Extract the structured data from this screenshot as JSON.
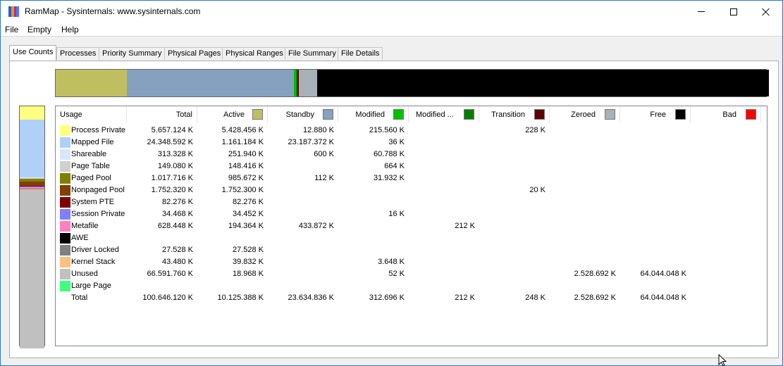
{
  "window": {
    "title": "RamMap - Sysinternals: www.sysinternals.com"
  },
  "menu": {
    "file": "File",
    "empty": "Empty",
    "help": "Help"
  },
  "tabs": [
    "Use Counts",
    "Processes",
    "Priority Summary",
    "Physical Pages",
    "Physical Ranges",
    "File Summary",
    "File Details"
  ],
  "active_tab": "Use Counts",
  "colors": {
    "active": "#bfbf60",
    "standby": "#86a0bf",
    "modified": "#00c000",
    "modified_no_write": "#008000",
    "transition": "#600000",
    "zeroed": "#a8b0b8",
    "free": "#000000",
    "bad": "#ff0000"
  },
  "columns": {
    "usage": "Usage",
    "total": "Total",
    "active": "Active",
    "standby": "Standby",
    "modified": "Modified",
    "modified_nw": "Modified ...",
    "transition": "Transition",
    "zeroed": "Zeroed",
    "free": "Free",
    "bad": "Bad"
  },
  "rows": [
    {
      "label": "Process Private",
      "color": "#ffff80",
      "total": "5.657.124 K",
      "active": "5.428.456 K",
      "standby": "12.880 K",
      "modified": "215.560 K",
      "modified_nw": "",
      "transition": "228 K",
      "zeroed": "",
      "free": ""
    },
    {
      "label": "Mapped File",
      "color": "#b0d0f8",
      "total": "24.348.592 K",
      "active": "1.161.184 K",
      "standby": "23.187.372 K",
      "modified": "36 K",
      "modified_nw": "",
      "transition": "",
      "zeroed": "",
      "free": ""
    },
    {
      "label": "Shareable",
      "color": "#d8e8f8",
      "total": "313.328 K",
      "active": "251.940 K",
      "standby": "600 K",
      "modified": "60.788 K",
      "modified_nw": "",
      "transition": "",
      "zeroed": "",
      "free": ""
    },
    {
      "label": "Page Table",
      "color": "#d0d0d0",
      "total": "149.080 K",
      "active": "148.416 K",
      "standby": "",
      "modified": "664 K",
      "modified_nw": "",
      "transition": "",
      "zeroed": "",
      "free": ""
    },
    {
      "label": "Paged Pool",
      "color": "#808000",
      "total": "1.017.716 K",
      "active": "985.672 K",
      "standby": "112 K",
      "modified": "31.932 K",
      "modified_nw": "",
      "transition": "",
      "zeroed": "",
      "free": ""
    },
    {
      "label": "Nonpaged Pool",
      "color": "#804000",
      "total": "1.752.320 K",
      "active": "1.752.300 K",
      "standby": "",
      "modified": "",
      "modified_nw": "",
      "transition": "20 K",
      "zeroed": "",
      "free": ""
    },
    {
      "label": "System PTE",
      "color": "#800000",
      "total": "82.276 K",
      "active": "82.276 K",
      "standby": "",
      "modified": "",
      "modified_nw": "",
      "transition": "",
      "zeroed": "",
      "free": ""
    },
    {
      "label": "Session Private",
      "color": "#8080ff",
      "total": "34.468 K",
      "active": "34.452 K",
      "standby": "",
      "modified": "16 K",
      "modified_nw": "",
      "transition": "",
      "zeroed": "",
      "free": ""
    },
    {
      "label": "Metafile",
      "color": "#ff80c0",
      "total": "628.448 K",
      "active": "194.364 K",
      "standby": "433.872 K",
      "modified": "",
      "modified_nw": "212 K",
      "transition": "",
      "zeroed": "",
      "free": ""
    },
    {
      "label": "AWE",
      "color": "#000000",
      "total": "",
      "active": "",
      "standby": "",
      "modified": "",
      "modified_nw": "",
      "transition": "",
      "zeroed": "",
      "free": ""
    },
    {
      "label": "Driver Locked",
      "color": "#808080",
      "total": "27.528 K",
      "active": "27.528 K",
      "standby": "",
      "modified": "",
      "modified_nw": "",
      "transition": "",
      "zeroed": "",
      "free": ""
    },
    {
      "label": "Kernel Stack",
      "color": "#ffc080",
      "total": "43.480 K",
      "active": "39.832 K",
      "standby": "",
      "modified": "3.648 K",
      "modified_nw": "",
      "transition": "",
      "zeroed": "",
      "free": ""
    },
    {
      "label": "Unused",
      "color": "#c0c0c0",
      "total": "66.591.760 K",
      "active": "18.968 K",
      "standby": "",
      "modified": "52 K",
      "modified_nw": "",
      "transition": "",
      "zeroed": "2.528.692 K",
      "free": "64.044.048 K"
    },
    {
      "label": "Large Page",
      "color": "#40ff80",
      "total": "",
      "active": "",
      "standby": "",
      "modified": "",
      "modified_nw": "",
      "transition": "",
      "zeroed": "",
      "free": ""
    },
    {
      "label": "Total",
      "color": "",
      "total": "100.646.120 K",
      "active": "10.125.388 K",
      "standby": "23.634.836 K",
      "modified": "312.696 K",
      "modified_nw": "212 K",
      "transition": "248 K",
      "zeroed": "2.528.692 K",
      "free": "64.044.048 K"
    }
  ],
  "memory_bar": [
    {
      "state": "active",
      "color": "#bfbf60",
      "kb": 10125388
    },
    {
      "state": "standby",
      "color": "#86a0bf",
      "kb": 23634836
    },
    {
      "state": "modified",
      "color": "#00c000",
      "kb": 312696
    },
    {
      "state": "modified_no_write",
      "color": "#008000",
      "kb": 212
    },
    {
      "state": "transition",
      "color": "#600000",
      "kb": 248
    },
    {
      "state": "zeroed",
      "color": "#a8b0b8",
      "kb": 2528692
    },
    {
      "state": "free",
      "color": "#000000",
      "kb": 64044048
    }
  ],
  "usage_bar": [
    {
      "usage": "process-private",
      "color": "#ffff80",
      "kb": 5657124
    },
    {
      "usage": "mapped-file",
      "color": "#b0d0f8",
      "kb": 24348592
    },
    {
      "usage": "shareable",
      "color": "#d8e8f8",
      "kb": 313328
    },
    {
      "usage": "page-table",
      "color": "#d0d0d0",
      "kb": 149080
    },
    {
      "usage": "paged-pool",
      "color": "#808000",
      "kb": 1017716
    },
    {
      "usage": "nonpaged-pool",
      "color": "#804000",
      "kb": 1752320
    },
    {
      "usage": "system-pte",
      "color": "#800000",
      "kb": 82276
    },
    {
      "usage": "session-private",
      "color": "#8080ff",
      "kb": 34468
    },
    {
      "usage": "metafile",
      "color": "#ff80c0",
      "kb": 628448
    },
    {
      "usage": "driver-locked",
      "color": "#808080",
      "kb": 27528
    },
    {
      "usage": "kernel-stack",
      "color": "#ffc080",
      "kb": 43480
    },
    {
      "usage": "unused",
      "color": "#c0c0c0",
      "kb": 66591760
    }
  ]
}
